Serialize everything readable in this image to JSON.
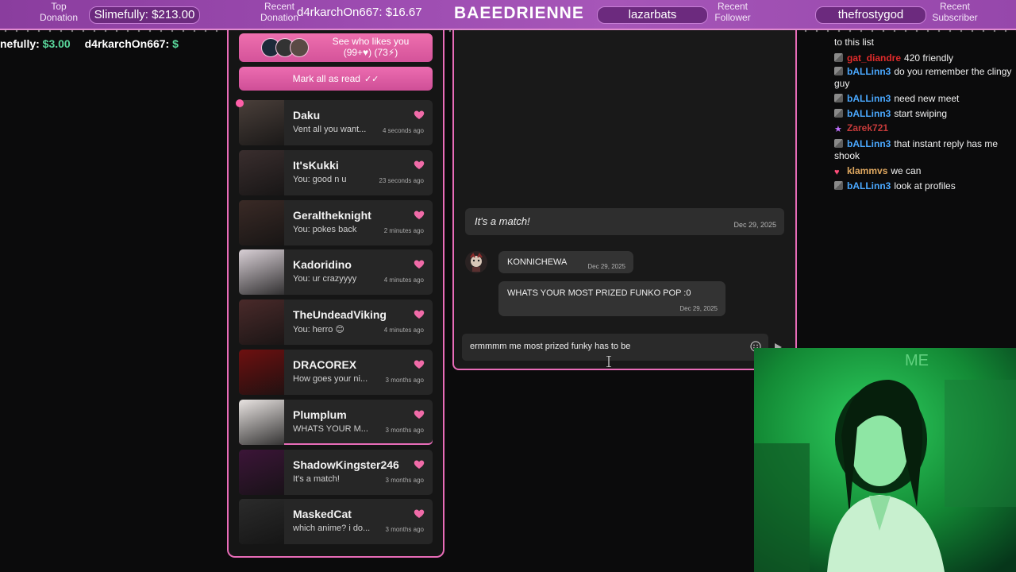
{
  "stream": {
    "top_donation_label": "Top\nDonation",
    "top_donation_value": "Slimefully: $213.00",
    "recent_donation_label": "Recent\nDonation",
    "recent_donation_value": "d4rkarchOn667: $16.67",
    "brand": "BAEEDRIENNE",
    "recent_follower_value": "lazarbats",
    "recent_follower_label": "Recent\nFollower",
    "recent_subscriber_value": "thefrostygod",
    "recent_subscriber_label": "Recent\nSubscriber",
    "ticker": [
      {
        "name": "nefully: ",
        "amount": "$3.00"
      },
      {
        "name": "d4rkarchOn667: ",
        "amount": "$"
      }
    ]
  },
  "matches": {
    "likes_label": "See who likes you",
    "likes_counts": "(99+♥) (73⚡)",
    "mark_all_read": "Mark all as read",
    "mark_all_read_icon": "✓✓",
    "rows": [
      {
        "name": "Daku",
        "message": "Vent all you want...",
        "time": "4 seconds ago"
      },
      {
        "name": "It'sKukki",
        "message": "You: good n u",
        "time": "23 seconds ago"
      },
      {
        "name": "Geraltheknight",
        "message": "You: pokes back",
        "time": "2 minutes ago"
      },
      {
        "name": "Kadoridino",
        "message": "You: ur crazyyyy",
        "time": "4 minutes ago"
      },
      {
        "name": "TheUndeadViking",
        "message": "You: herro 😊",
        "time": "4 minutes ago"
      },
      {
        "name": "DRACOREX",
        "message": "How goes your ni...",
        "time": "3 months ago"
      },
      {
        "name": "Plumplum",
        "message": "WHATS YOUR M...",
        "time": "3 months ago"
      },
      {
        "name": "ShadowKingster246",
        "message": "It's a match!",
        "time": "3 months ago"
      },
      {
        "name": "MaskedCat",
        "message": "which anime? i do...",
        "time": "3 months ago"
      }
    ],
    "thumb_colors": [
      "#4a3f3a",
      "#3a2e2e",
      "#3a2a26",
      "#d9d0d6",
      "#4a2a2a",
      "#6e1010",
      "#e9e4e2",
      "#3c1538",
      "#2b2b2b"
    ]
  },
  "conversation": {
    "match_text": "It's a match!",
    "match_date": "Dec 29, 2025",
    "sender": "KONNICHEWA",
    "sender_date": "Dec 29, 2025",
    "message": "WHATS YOUR MOST PRIZED FUNKO POP :0",
    "message_date": "Dec 29, 2025",
    "draft": "ermmmm me most prized funky has to be"
  },
  "twitch_chat": [
    {
      "badge": "",
      "user": "",
      "user_color": "#ffffff",
      "text": "to this list"
    },
    {
      "badge": "grey",
      "user": "gat_diandre",
      "user_color": "#e02b2b",
      "text": "420 friendly"
    },
    {
      "badge": "grey",
      "user": "bALLinn3",
      "user_color": "#4aa8ff",
      "text": "do you remember the clingy guy"
    },
    {
      "badge": "grey",
      "user": "bALLinn3",
      "user_color": "#4aa8ff",
      "text": "need new meet"
    },
    {
      "badge": "grey",
      "user": "bALLinn3",
      "user_color": "#4aa8ff",
      "text": "start swiping"
    },
    {
      "badge": "star",
      "user": "Zarek721",
      "user_color": "#c63a3a",
      "text": ""
    },
    {
      "badge": "grey",
      "user": "bALLinn3",
      "user_color": "#4aa8ff",
      "text": "that instant reply has me shook"
    },
    {
      "badge": "heart",
      "user": "klammvs",
      "user_color": "#e0a860",
      "text": "we can"
    },
    {
      "badge": "grey",
      "user": "bALLinn3",
      "user_color": "#4aa8ff",
      "text": "look at profiles"
    }
  ],
  "colors": {
    "accent": "#e86cb8",
    "panel_bg": "#151515",
    "row_bg": "#262626",
    "heart": "#f06ba8",
    "webcam_tint": "#1fae4a"
  }
}
